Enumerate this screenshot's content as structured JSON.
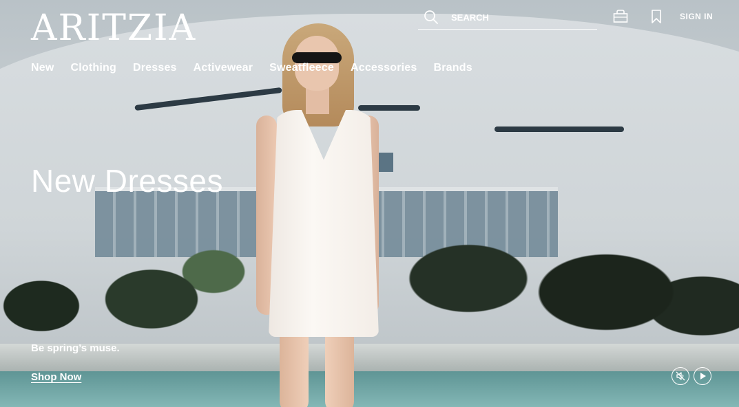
{
  "brand": {
    "logo_text": "ARITZIA"
  },
  "header": {
    "search": {
      "placeholder": "SEARCH"
    },
    "signin_label": "SIGN IN"
  },
  "nav": {
    "items": [
      {
        "label": "New"
      },
      {
        "label": "Clothing"
      },
      {
        "label": "Dresses"
      },
      {
        "label": "Activewear"
      },
      {
        "label": "Sweatfleece"
      },
      {
        "label": "Accessories"
      },
      {
        "label": "Brands"
      }
    ]
  },
  "hero": {
    "headline": "New Dresses",
    "tagline": "Be spring’s muse.",
    "cta_label": "Shop Now"
  },
  "icons": {
    "search": "search-icon",
    "bag": "shopping-bag-icon",
    "wishlist": "bookmark-icon",
    "mute": "mute-icon",
    "play": "play-icon"
  },
  "colors": {
    "overlay_text": "#ffffff"
  }
}
